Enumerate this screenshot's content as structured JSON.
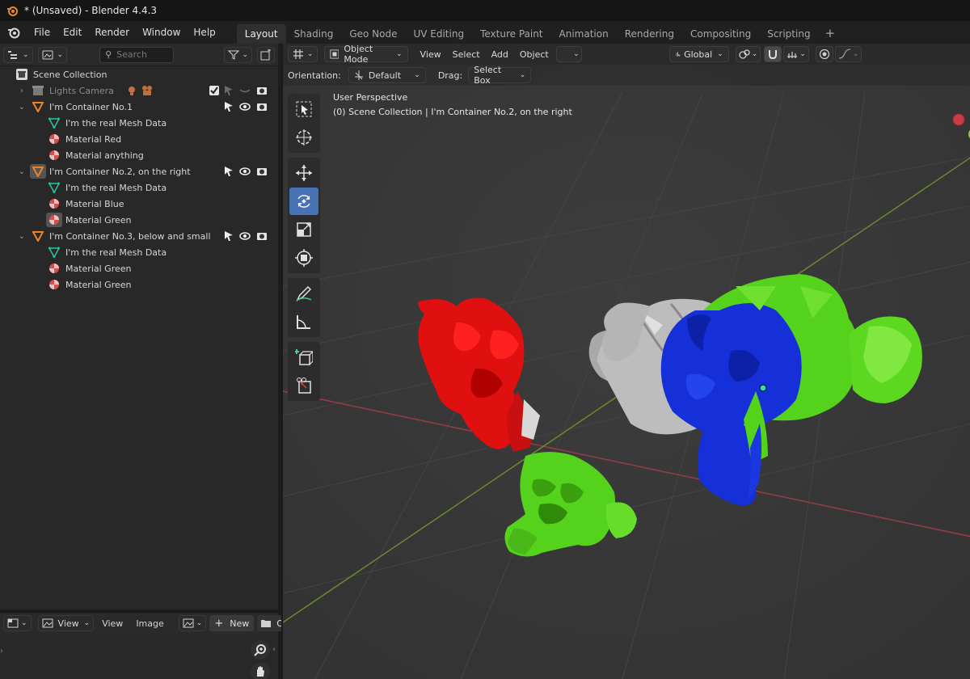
{
  "window": {
    "title": "* (Unsaved) - Blender 4.4.3"
  },
  "menu": [
    "File",
    "Edit",
    "Render",
    "Window",
    "Help"
  ],
  "workspaces": {
    "tabs": [
      "Layout",
      "Shading",
      "Geo Node",
      "UV Editing",
      "Texture Paint",
      "Animation",
      "Rendering",
      "Compositing",
      "Scripting"
    ],
    "active": "Layout",
    "add_symbol": "+"
  },
  "outliner": {
    "search_placeholder": "Search",
    "rows": [
      {
        "label": "Scene Collection",
        "icon": "scene-collection-icon"
      },
      {
        "label": "Lights Camera",
        "icon": "collection-icon",
        "dim": true
      },
      {
        "label": "I'm Container No.1",
        "icon": "object-icon"
      },
      {
        "label": "I'm the real  Mesh Data",
        "icon": "mesh-data-icon"
      },
      {
        "label": "Material Red",
        "icon": "material-icon"
      },
      {
        "label": "Material anything",
        "icon": "material-icon"
      },
      {
        "label": "I'm Container No.2, on the right",
        "icon": "object-icon"
      },
      {
        "label": "I'm the real  Mesh Data",
        "icon": "mesh-data-icon"
      },
      {
        "label": "Material Blue",
        "icon": "material-icon"
      },
      {
        "label": "Material Green",
        "icon": "material-icon"
      },
      {
        "label": "I'm Container No.3, below and small",
        "icon": "object-icon"
      },
      {
        "label": "I'm the real  Mesh Data",
        "icon": "mesh-data-icon"
      },
      {
        "label": "Material Green",
        "icon": "material-icon"
      },
      {
        "label": "Material Green",
        "icon": "material-icon"
      }
    ]
  },
  "image_editor": {
    "view_dd": "View",
    "view": "View",
    "image": "Image",
    "new": "New",
    "open_partial": "Op"
  },
  "viewport": {
    "mode": "Object Mode",
    "menus": [
      "View",
      "Select",
      "Add",
      "Object"
    ],
    "transform_space": "Global",
    "orientation_label": "Orientation:",
    "orientation_value": "Default",
    "drag_label": "Drag:",
    "drag_value": "Select Box",
    "perspective": "User Perspective",
    "context": "(0) Scene Collection | I'm Container No.2, on the right"
  },
  "colors": {
    "accent": "#4772b3",
    "material_red": "#e01010",
    "material_green": "#55d21c",
    "material_blue": "#1530d8",
    "object_orange": "#e8862c",
    "mesh_teal": "#27c4a4"
  }
}
